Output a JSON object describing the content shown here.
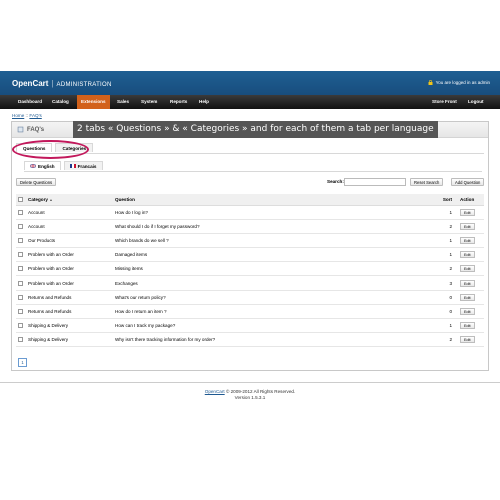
{
  "header": {
    "brand": "OpenCart",
    "subtitle": "ADMINISTRATION",
    "login_status": "You are logged in as admin"
  },
  "menu": {
    "left": [
      "Dashboard",
      "Catalog",
      "Extensions",
      "Sales",
      "System",
      "Reports",
      "Help"
    ],
    "active": "Extensions",
    "right": [
      "Store Front",
      "Logout"
    ]
  },
  "breadcrumb": [
    "Home",
    "FAQ's"
  ],
  "page": {
    "title": "FAQ's",
    "callout": "2 tabs « Questions » & « Categories » and for each of them a tab per language"
  },
  "tabs": [
    "Questions",
    "Categories"
  ],
  "language_tabs": [
    "English",
    "Francais"
  ],
  "toolbar": {
    "delete_label": "Delete Questions",
    "search_label": "Search:",
    "search_value": "",
    "reset_label": "Reset Search",
    "add_label": "Add Question"
  },
  "table": {
    "headers": [
      "Category",
      "Question",
      "Sort",
      "Action"
    ],
    "rows": [
      {
        "category": "Account",
        "question": "How do I log in?",
        "sort": "1",
        "action": "Edit"
      },
      {
        "category": "Account",
        "question": "What should I do if I forget my password?",
        "sort": "2",
        "action": "Edit"
      },
      {
        "category": "Our Products",
        "question": "Which brands do we sell ?",
        "sort": "1",
        "action": "Edit"
      },
      {
        "category": "Problem with an Order",
        "question": "Damaged items",
        "sort": "1",
        "action": "Edit"
      },
      {
        "category": "Problem with an Order",
        "question": "Missing items",
        "sort": "2",
        "action": "Edit"
      },
      {
        "category": "Problem with an Order",
        "question": "Exchanges",
        "sort": "3",
        "action": "Edit"
      },
      {
        "category": "Returns and Refunds",
        "question": "What's our return policy?",
        "sort": "0",
        "action": "Edit"
      },
      {
        "category": "Returns and Refunds",
        "question": "How do I return an item ?",
        "sort": "0",
        "action": "Edit"
      },
      {
        "category": "Shipping & Delivery",
        "question": "How can I track my package?",
        "sort": "1",
        "action": "Edit"
      },
      {
        "category": "Shipping & Delivery",
        "question": "Why isn't there tracking information for my order?",
        "sort": "2",
        "action": "Edit"
      }
    ]
  },
  "pagination": {
    "current": "1"
  },
  "footer": {
    "link": "OpenCart",
    "copyright": "© 2009-2012 All Rights Reserved.",
    "version": "Version 1.5.3.1"
  },
  "colors": {
    "header": "#1f5f93",
    "menu_active": "#d2611a",
    "highlight": "#c2185b"
  },
  "icons": [
    "lock-icon",
    "book-icon",
    "uk-flag-icon",
    "france-flag-icon"
  ]
}
